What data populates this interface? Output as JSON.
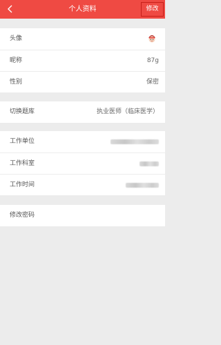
{
  "header": {
    "title": "个人资料",
    "edit_label": "修改",
    "back_icon": "chevron-left-icon"
  },
  "profile": {
    "avatar_label": "头像",
    "nickname_label": "昵称",
    "nickname_value": "87g",
    "gender_label": "性别",
    "gender_value": "保密"
  },
  "question_bank": {
    "label": "切换题库",
    "value": "执业医师（临床医学）"
  },
  "work": {
    "unit_label": "工作单位",
    "department_label": "工作科室",
    "time_label": "工作时间"
  },
  "password": {
    "label": "修改密码"
  },
  "colors": {
    "header_bg": "#ef4a43",
    "page_bg": "#ececec"
  }
}
